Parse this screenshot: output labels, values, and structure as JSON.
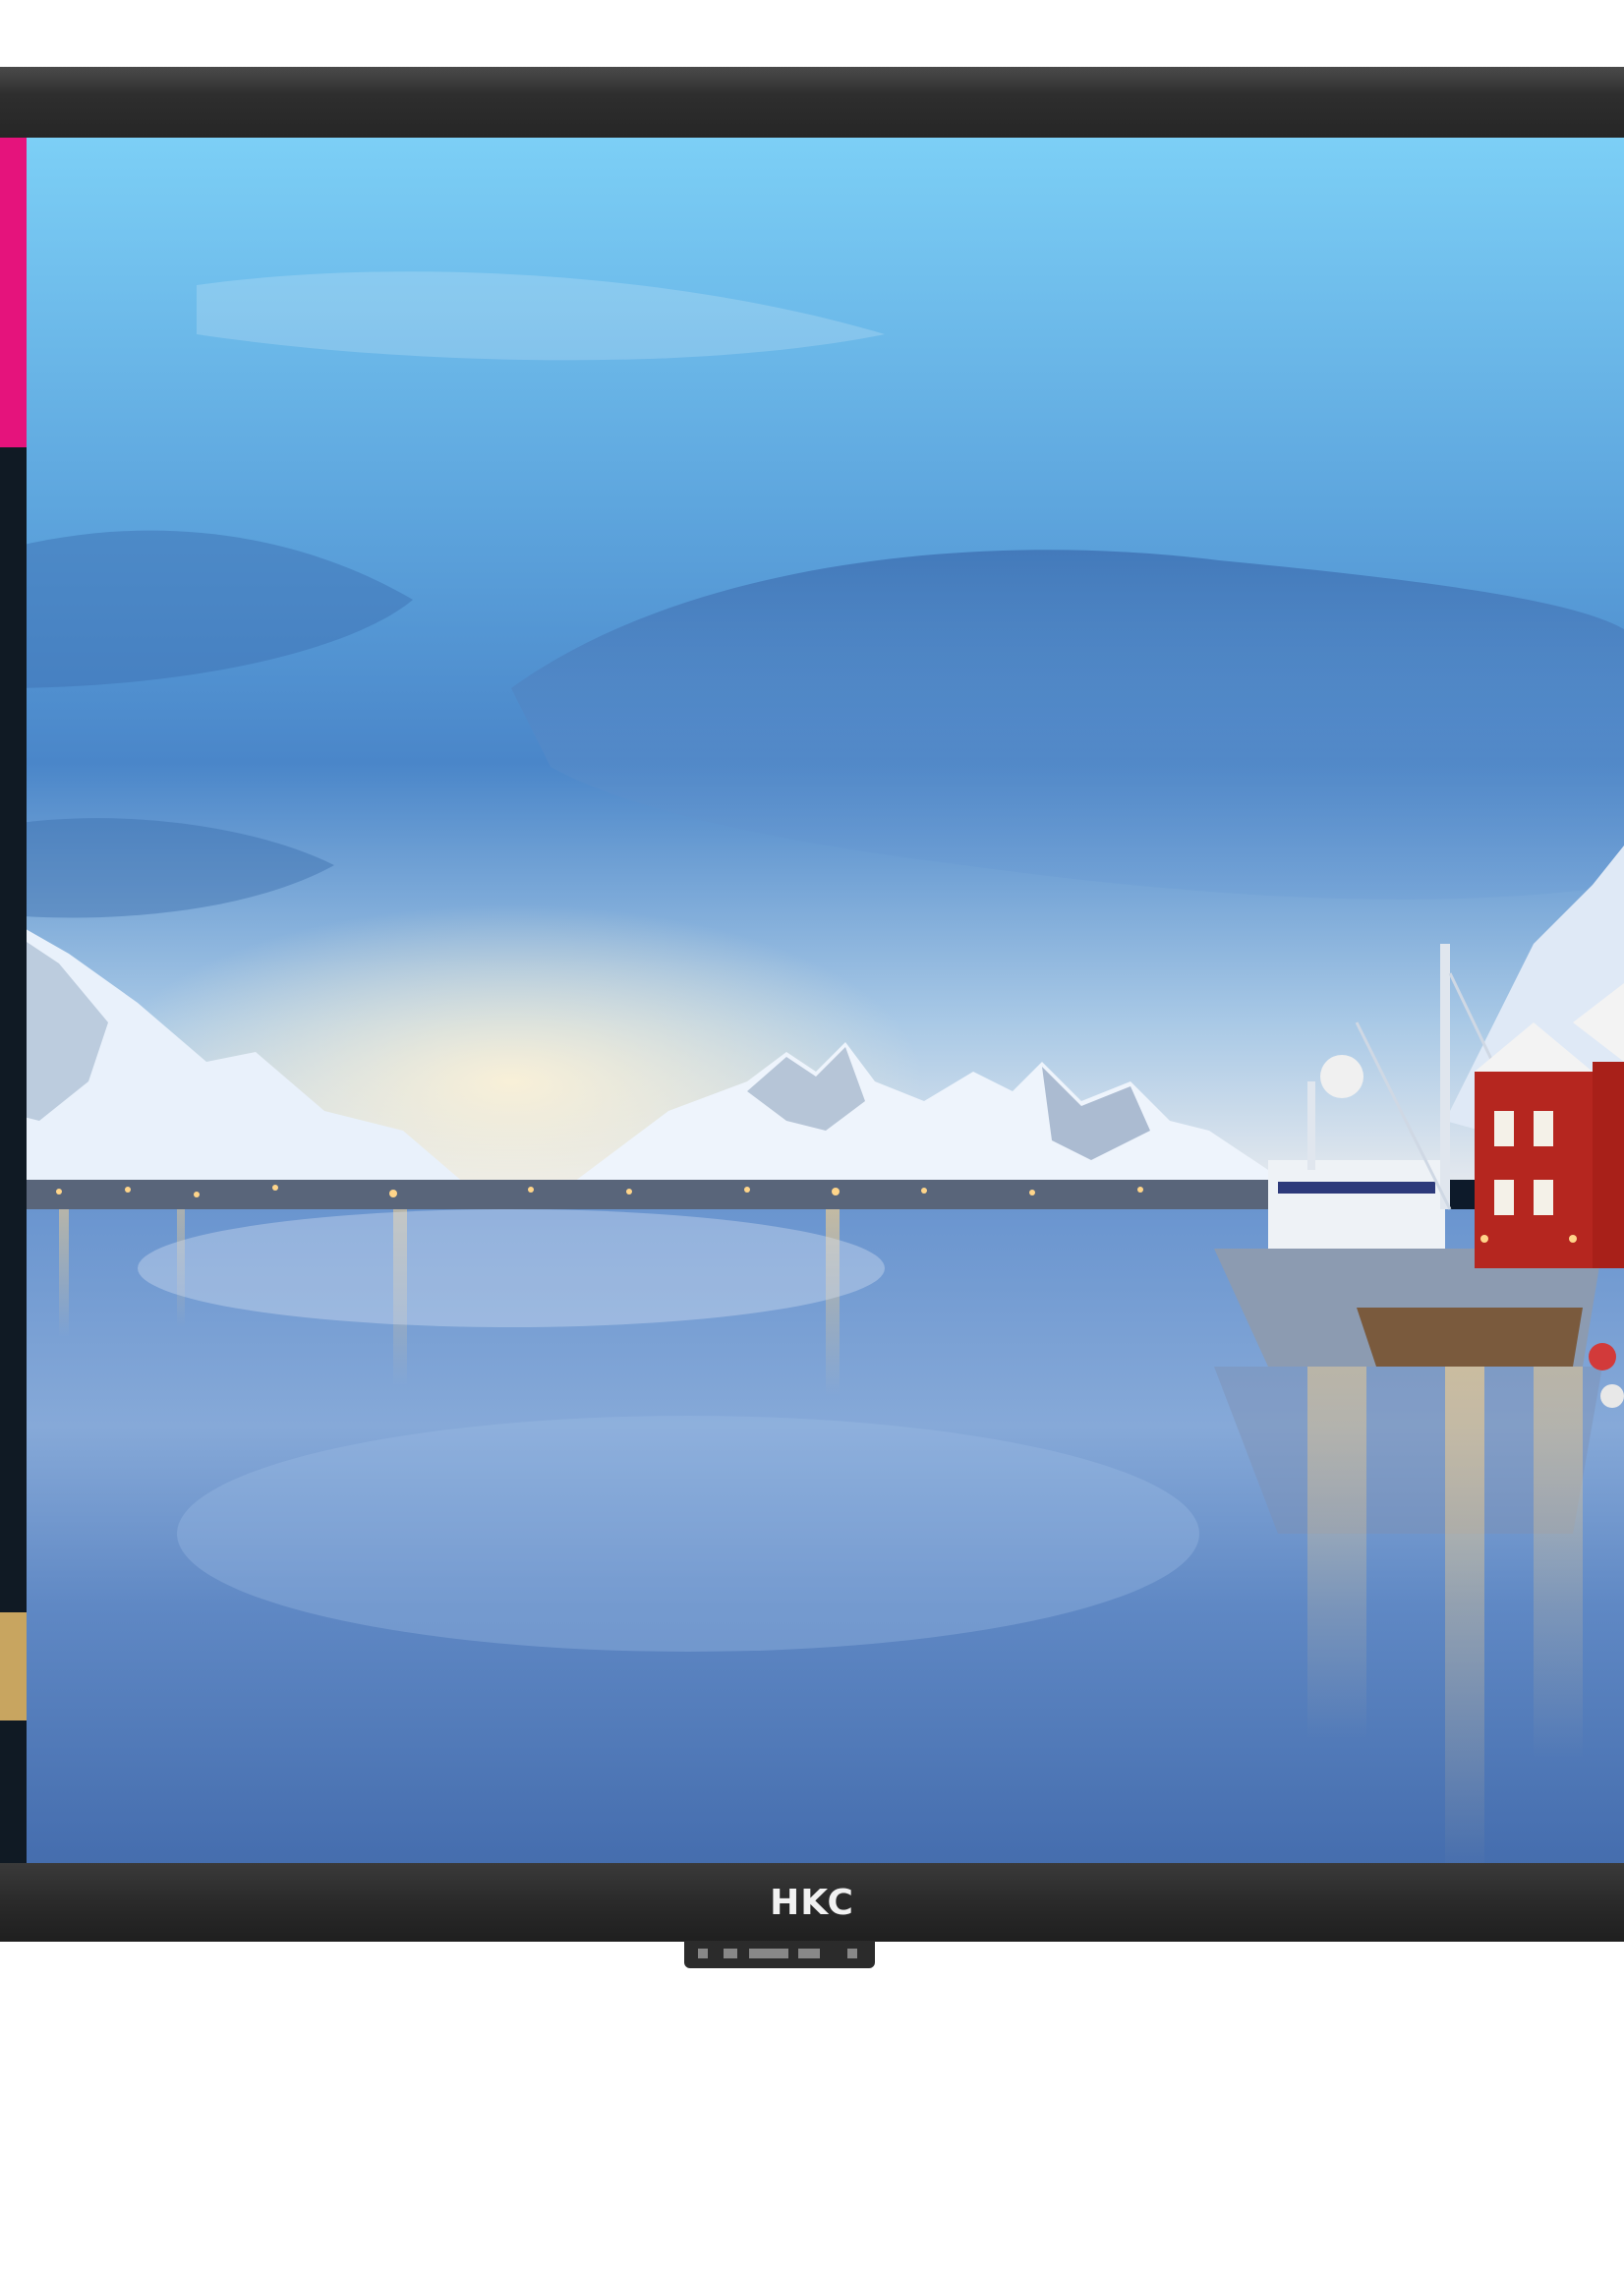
{
  "product": {
    "brand_logo": "HKC",
    "frame_color": "#2a2a2a",
    "screen_image": "arctic-harbor-landscape"
  },
  "colors": {
    "sky_top": "#6fc3ef",
    "sky_mid": "#4b8fd0",
    "water": "#4f7fc0",
    "snow": "#f0f6ff",
    "ship_hull": "#8a9bb0",
    "house_red": "#b3261e",
    "left_accent_pink": "#e5137c",
    "left_accent_gold": "#c8a560"
  }
}
